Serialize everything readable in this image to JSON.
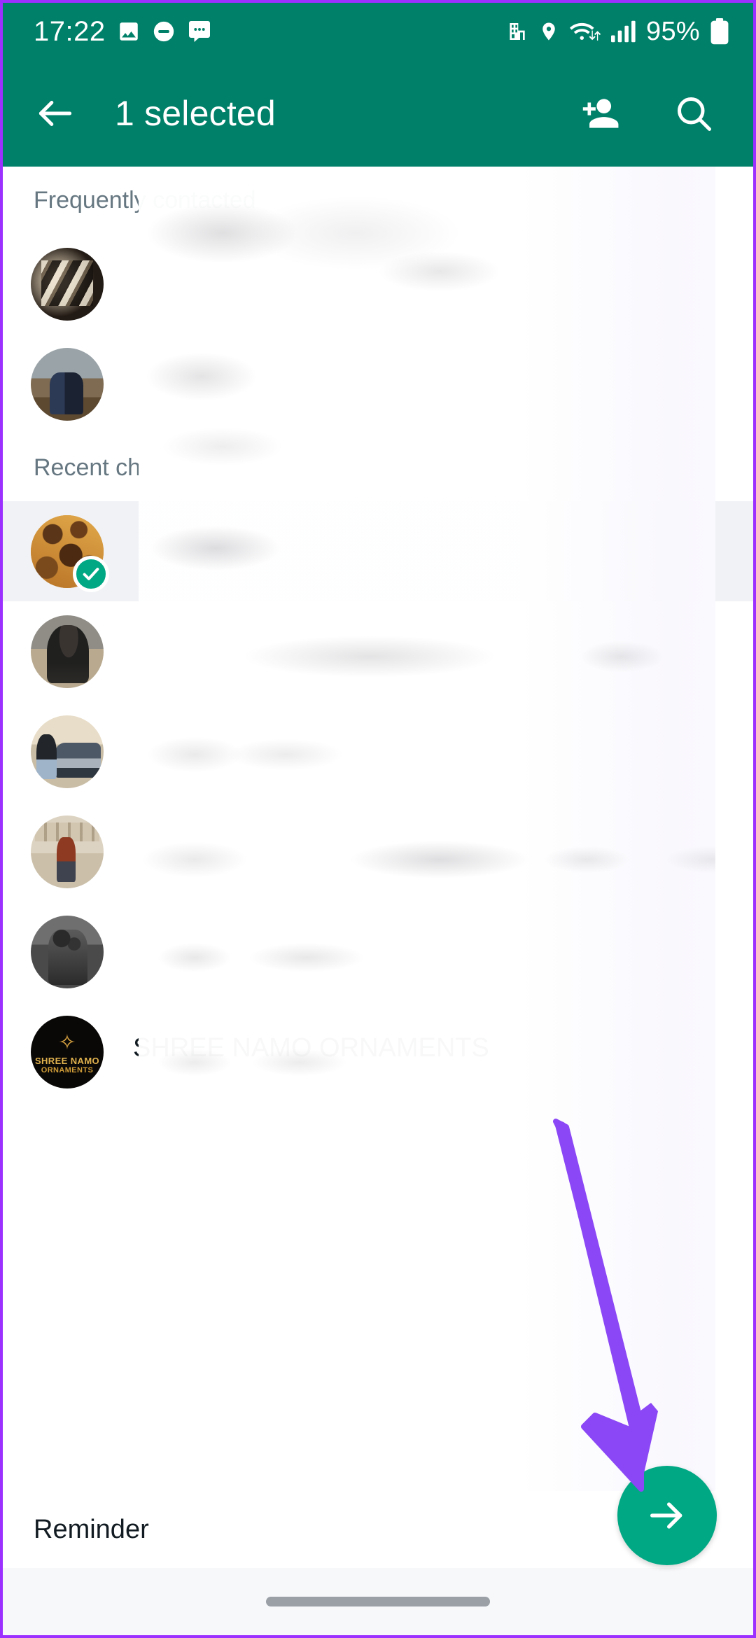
{
  "statusbar": {
    "clock": "17:22",
    "battery_percent": "95%",
    "left_icons": [
      "photo-icon",
      "do-not-disturb-icon",
      "chat-bubble-icon"
    ],
    "right_icons": [
      "building-icon",
      "location-pin-icon",
      "wifi-icon",
      "signal-bars-icon",
      "battery-icon"
    ],
    "bar_color": "#008069"
  },
  "toolbar": {
    "back_label": "back-arrow",
    "title": "1 selected",
    "add_person_label": "add-person",
    "search_label": "search",
    "bar_color": "#008069"
  },
  "sections": {
    "frequently_contacted": "Frequently contacted",
    "recent_chats": "Recent ch"
  },
  "frequent_contacts": [
    {
      "name": "",
      "subtitle": "",
      "avatar": "av-shop",
      "selected": false
    },
    {
      "name": "",
      "subtitle": "",
      "avatar": "av-couple1",
      "selected": false
    }
  ],
  "recent_chats": [
    {
      "name": "",
      "subtitle": "",
      "avatar": "av-collage",
      "selected": true
    },
    {
      "name": "",
      "subtitle": "",
      "avatar": "av-desert",
      "selected": false
    },
    {
      "name": "",
      "subtitle": "",
      "avatar": "av-car",
      "selected": false
    },
    {
      "name": "",
      "subtitle": "",
      "avatar": "av-street",
      "selected": false
    },
    {
      "name": "",
      "subtitle": "",
      "avatar": "av-bw",
      "selected": false
    },
    {
      "name": "SHREE NAMO ORNAMENTS",
      "subtitle": "",
      "avatar": "av-logo",
      "selected": false
    }
  ],
  "logo_avatar": {
    "mark": "✧",
    "line1": "SHREE NAMO",
    "line2": "ORNAMENTS"
  },
  "bottom": {
    "label": "Reminder",
    "send_button": "send-forward",
    "fab_color": "#00A884"
  },
  "annotation": {
    "arrow": "down-right-arrow",
    "color": "#8B47F5"
  },
  "selection": {
    "checkmark": "check-icon",
    "badge_color": "#00A884",
    "row_highlight": "#F0F2F5"
  }
}
